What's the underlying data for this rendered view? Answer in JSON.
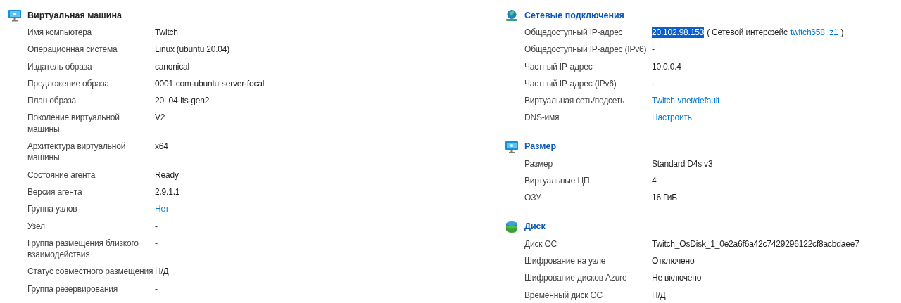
{
  "columns": [
    {
      "sections": [
        {
          "title": "Виртуальная машина",
          "rows": [
            {
              "label": "Имя компьютера",
              "value": [
                {
                  "text": "Twitch",
                  "kind": "text"
                }
              ]
            },
            {
              "label": "Операционная система",
              "value": [
                {
                  "text": "Linux (ubuntu 20.04)",
                  "kind": "text"
                }
              ]
            },
            {
              "label": "Издатель образа",
              "value": [
                {
                  "text": "canonical",
                  "kind": "text"
                }
              ]
            },
            {
              "label": "Предложение образа",
              "value": [
                {
                  "text": "0001-com-ubuntu-server-focal",
                  "kind": "text"
                }
              ]
            },
            {
              "label": "План образа",
              "value": [
                {
                  "text": "20_04-lts-gen2",
                  "kind": "text"
                }
              ]
            },
            {
              "label": "Поколение виртуальной машины",
              "value": [
                {
                  "text": "V2",
                  "kind": "text"
                }
              ]
            },
            {
              "label": "Архитектура виртуальной машины",
              "value": [
                {
                  "text": "x64",
                  "kind": "text"
                }
              ]
            },
            {
              "label": "Состояние агента",
              "value": [
                {
                  "text": "Ready",
                  "kind": "text"
                }
              ]
            },
            {
              "label": "Версия агента",
              "value": [
                {
                  "text": "2.9.1.1",
                  "kind": "text"
                }
              ]
            },
            {
              "label": "Группа узлов",
              "value": [
                {
                  "text": "Нет",
                  "kind": "link"
                }
              ]
            },
            {
              "label": "Узел",
              "value": [
                {
                  "text": "-",
                  "kind": "text"
                }
              ]
            },
            {
              "label": "Группа размещения близкого взаимодействия",
              "value": [
                {
                  "text": "-",
                  "kind": "text"
                }
              ]
            },
            {
              "label": "Статус совместного размещения",
              "value": [
                {
                  "text": "Н/Д",
                  "kind": "text"
                }
              ]
            },
            {
              "label": "Группа резервирования",
              "value": [
                {
                  "text": "-",
                  "kind": "text"
                }
              ]
            }
          ]
        }
      ]
    },
    {
      "sections": [
        {
          "title": "Сетевые подключения",
          "rows": [
            {
              "label": "Общедоступный IP-адрес",
              "value": [
                {
                  "text": "20.102.98.153",
                  "kind": "selected"
                },
                {
                  "text": "( Сетевой интерфейс",
                  "kind": "text"
                },
                {
                  "text": "twitch658_z1",
                  "kind": "link"
                },
                {
                  "text": ")",
                  "kind": "text"
                }
              ]
            },
            {
              "label": "Общедоступный IP-адрес (IPv6)",
              "value": [
                {
                  "text": "-",
                  "kind": "text"
                }
              ]
            },
            {
              "label": "Частный IP-адрес",
              "value": [
                {
                  "text": "10.0.0.4",
                  "kind": "text"
                }
              ]
            },
            {
              "label": "Частный IP-адрес (IPv6)",
              "value": [
                {
                  "text": "-",
                  "kind": "text"
                }
              ]
            },
            {
              "label": "Виртуальная сеть/подсеть",
              "value": [
                {
                  "text": "Twitch-vnet/default",
                  "kind": "link"
                }
              ]
            },
            {
              "label": "DNS-имя",
              "value": [
                {
                  "text": "Настроить",
                  "kind": "link"
                }
              ]
            }
          ]
        },
        {
          "title": "Размер",
          "rows": [
            {
              "label": "Размер",
              "value": [
                {
                  "text": "Standard D4s v3",
                  "kind": "text"
                }
              ]
            },
            {
              "label": "Виртуальные ЦП",
              "value": [
                {
                  "text": "4",
                  "kind": "text"
                }
              ]
            },
            {
              "label": "ОЗУ",
              "value": [
                {
                  "text": "16 ГиБ",
                  "kind": "text"
                }
              ]
            }
          ]
        },
        {
          "title": "Диск",
          "rows": [
            {
              "label": "Диск ОС",
              "value": [
                {
                  "text": "Twitch_OsDisk_1_0e2a6f6a42c7429296122cf8acbdaee7",
                  "kind": "text"
                }
              ]
            },
            {
              "label": "Шифрование на узле",
              "value": [
                {
                  "text": "Отключено",
                  "kind": "text"
                }
              ]
            },
            {
              "label": "Шифрование дисков Azure",
              "value": [
                {
                  "text": "Не включено",
                  "kind": "text"
                }
              ]
            },
            {
              "label": "Временный диск ОС",
              "value": [
                {
                  "text": "Н/Д",
                  "kind": "text"
                }
              ]
            }
          ]
        }
      ]
    }
  ]
}
